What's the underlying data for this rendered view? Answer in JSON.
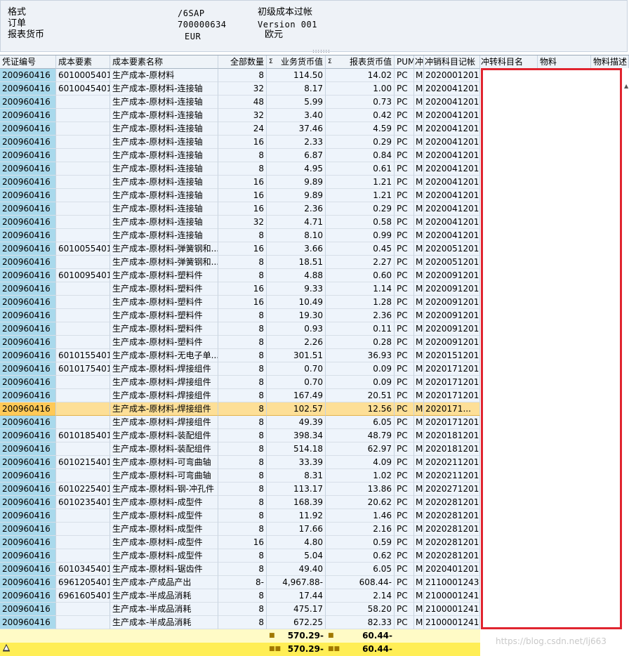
{
  "header": {
    "rows": [
      {
        "label": "格式",
        "value": "/6SAP",
        "extra": "初级成本过帐"
      },
      {
        "label": "订单",
        "value": "700000634",
        "extra": "Version 001"
      },
      {
        "label": "报表货币",
        "value": "EUR",
        "extra": "欧元"
      }
    ]
  },
  "columns": {
    "voucher": "凭证编号",
    "cost_element": "成本要素",
    "cost_element_name": "成本要素名称",
    "total_qty": "全部数量",
    "business_currency_value": "业务货币值",
    "report_currency_value": "报表货币值",
    "pum": "PUM",
    "rev": "冲",
    "offset_account": "冲销科目记帐",
    "offset_account_name": "冲转科目名",
    "material": "物料",
    "material_desc": "物料描述",
    "sigma": "Σ"
  },
  "rows": [
    {
      "v": "200960416",
      "ce": "6010005401",
      "name": "生产成本-原材料",
      "qty": "8",
      "bv": "114.50",
      "rv": "14.02",
      "pum": "PC",
      "m": "M",
      "acc": "2020001201"
    },
    {
      "v": "200960416",
      "ce": "6010045401",
      "name": "生产成本-原材料-连接轴",
      "qty": "32",
      "bv": "8.17",
      "rv": "1.00",
      "pum": "PC",
      "m": "M",
      "acc": "2020041201"
    },
    {
      "v": "200960416",
      "ce": "",
      "name": "生产成本-原材料-连接轴",
      "qty": "48",
      "bv": "5.99",
      "rv": "0.73",
      "pum": "PC",
      "m": "M",
      "acc": "2020041201"
    },
    {
      "v": "200960416",
      "ce": "",
      "name": "生产成本-原材料-连接轴",
      "qty": "32",
      "bv": "3.40",
      "rv": "0.42",
      "pum": "PC",
      "m": "M",
      "acc": "2020041201"
    },
    {
      "v": "200960416",
      "ce": "",
      "name": "生产成本-原材料-连接轴",
      "qty": "24",
      "bv": "37.46",
      "rv": "4.59",
      "pum": "PC",
      "m": "M",
      "acc": "2020041201"
    },
    {
      "v": "200960416",
      "ce": "",
      "name": "生产成本-原材料-连接轴",
      "qty": "16",
      "bv": "2.33",
      "rv": "0.29",
      "pum": "PC",
      "m": "M",
      "acc": "2020041201"
    },
    {
      "v": "200960416",
      "ce": "",
      "name": "生产成本-原材料-连接轴",
      "qty": "8",
      "bv": "6.87",
      "rv": "0.84",
      "pum": "PC",
      "m": "M",
      "acc": "2020041201"
    },
    {
      "v": "200960416",
      "ce": "",
      "name": "生产成本-原材料-连接轴",
      "qty": "8",
      "bv": "4.95",
      "rv": "0.61",
      "pum": "PC",
      "m": "M",
      "acc": "2020041201"
    },
    {
      "v": "200960416",
      "ce": "",
      "name": "生产成本-原材料-连接轴",
      "qty": "16",
      "bv": "9.89",
      "rv": "1.21",
      "pum": "PC",
      "m": "M",
      "acc": "2020041201"
    },
    {
      "v": "200960416",
      "ce": "",
      "name": "生产成本-原材料-连接轴",
      "qty": "16",
      "bv": "9.89",
      "rv": "1.21",
      "pum": "PC",
      "m": "M",
      "acc": "2020041201"
    },
    {
      "v": "200960416",
      "ce": "",
      "name": "生产成本-原材料-连接轴",
      "qty": "16",
      "bv": "2.36",
      "rv": "0.29",
      "pum": "PC",
      "m": "M",
      "acc": "2020041201"
    },
    {
      "v": "200960416",
      "ce": "",
      "name": "生产成本-原材料-连接轴",
      "qty": "32",
      "bv": "4.71",
      "rv": "0.58",
      "pum": "PC",
      "m": "M",
      "acc": "2020041201"
    },
    {
      "v": "200960416",
      "ce": "",
      "name": "生产成本-原材料-连接轴",
      "qty": "8",
      "bv": "8.10",
      "rv": "0.99",
      "pum": "PC",
      "m": "M",
      "acc": "2020041201"
    },
    {
      "v": "200960416",
      "ce": "6010055401",
      "name": "生产成本-原材料-弹簧钢和...",
      "qty": "16",
      "bv": "3.66",
      "rv": "0.45",
      "pum": "PC",
      "m": "M",
      "acc": "2020051201"
    },
    {
      "v": "200960416",
      "ce": "",
      "name": "生产成本-原材料-弹簧钢和...",
      "qty": "8",
      "bv": "18.51",
      "rv": "2.27",
      "pum": "PC",
      "m": "M",
      "acc": "2020051201"
    },
    {
      "v": "200960416",
      "ce": "6010095401",
      "name": "生产成本-原材料-塑料件",
      "qty": "8",
      "bv": "4.88",
      "rv": "0.60",
      "pum": "PC",
      "m": "M",
      "acc": "2020091201"
    },
    {
      "v": "200960416",
      "ce": "",
      "name": "生产成本-原材料-塑料件",
      "qty": "16",
      "bv": "9.33",
      "rv": "1.14",
      "pum": "PC",
      "m": "M",
      "acc": "2020091201"
    },
    {
      "v": "200960416",
      "ce": "",
      "name": "生产成本-原材料-塑料件",
      "qty": "16",
      "bv": "10.49",
      "rv": "1.28",
      "pum": "PC",
      "m": "M",
      "acc": "2020091201"
    },
    {
      "v": "200960416",
      "ce": "",
      "name": "生产成本-原材料-塑料件",
      "qty": "8",
      "bv": "19.30",
      "rv": "2.36",
      "pum": "PC",
      "m": "M",
      "acc": "2020091201"
    },
    {
      "v": "200960416",
      "ce": "",
      "name": "生产成本-原材料-塑料件",
      "qty": "8",
      "bv": "0.93",
      "rv": "0.11",
      "pum": "PC",
      "m": "M",
      "acc": "2020091201"
    },
    {
      "v": "200960416",
      "ce": "",
      "name": "生产成本-原材料-塑料件",
      "qty": "8",
      "bv": "2.26",
      "rv": "0.28",
      "pum": "PC",
      "m": "M",
      "acc": "2020091201"
    },
    {
      "v": "200960416",
      "ce": "6010155401",
      "name": "生产成本-原材料-无电子单...",
      "qty": "8",
      "bv": "301.51",
      "rv": "36.93",
      "pum": "PC",
      "m": "M",
      "acc": "2020151201"
    },
    {
      "v": "200960416",
      "ce": "6010175401",
      "name": "生产成本-原材料-焊接组件",
      "qty": "8",
      "bv": "0.70",
      "rv": "0.09",
      "pum": "PC",
      "m": "M",
      "acc": "2020171201"
    },
    {
      "v": "200960416",
      "ce": "",
      "name": "生产成本-原材料-焊接组件",
      "qty": "8",
      "bv": "0.70",
      "rv": "0.09",
      "pum": "PC",
      "m": "M",
      "acc": "2020171201"
    },
    {
      "v": "200960416",
      "ce": "",
      "name": "生产成本-原材料-焊接组件",
      "qty": "8",
      "bv": "167.49",
      "rv": "20.51",
      "pum": "PC",
      "m": "M",
      "acc": "2020171201"
    },
    {
      "v": "200960416",
      "ce": "",
      "name": "生产成本-原材料-焊接组件",
      "qty": "8",
      "bv": "102.57",
      "rv": "12.56",
      "pum": "PC",
      "m": "M",
      "acc": "2020171...",
      "selected": true
    },
    {
      "v": "200960416",
      "ce": "",
      "name": "生产成本-原材料-焊接组件",
      "qty": "8",
      "bv": "49.39",
      "rv": "6.05",
      "pum": "PC",
      "m": "M",
      "acc": "2020171201"
    },
    {
      "v": "200960416",
      "ce": "6010185401",
      "name": "生产成本-原材料-装配组件",
      "qty": "8",
      "bv": "398.34",
      "rv": "48.79",
      "pum": "PC",
      "m": "M",
      "acc": "2020181201"
    },
    {
      "v": "200960416",
      "ce": "",
      "name": "生产成本-原材料-装配组件",
      "qty": "8",
      "bv": "514.18",
      "rv": "62.97",
      "pum": "PC",
      "m": "M",
      "acc": "2020181201"
    },
    {
      "v": "200960416",
      "ce": "6010215401",
      "name": "生产成本-原材料-可弯曲轴",
      "qty": "8",
      "bv": "33.39",
      "rv": "4.09",
      "pum": "PC",
      "m": "M",
      "acc": "2020211201"
    },
    {
      "v": "200960416",
      "ce": "",
      "name": "生产成本-原材料-可弯曲轴",
      "qty": "8",
      "bv": "8.31",
      "rv": "1.02",
      "pum": "PC",
      "m": "M",
      "acc": "2020211201"
    },
    {
      "v": "200960416",
      "ce": "6010225401",
      "name": "生产成本-原材料-钢-冲孔件",
      "qty": "8",
      "bv": "113.17",
      "rv": "13.86",
      "pum": "PC",
      "m": "M",
      "acc": "2020271201"
    },
    {
      "v": "200960416",
      "ce": "6010235401",
      "name": "生产成本-原材料-成型件",
      "qty": "8",
      "bv": "168.39",
      "rv": "20.62",
      "pum": "PC",
      "m": "M",
      "acc": "2020281201"
    },
    {
      "v": "200960416",
      "ce": "",
      "name": "生产成本-原材料-成型件",
      "qty": "8",
      "bv": "11.92",
      "rv": "1.46",
      "pum": "PC",
      "m": "M",
      "acc": "2020281201"
    },
    {
      "v": "200960416",
      "ce": "",
      "name": "生产成本-原材料-成型件",
      "qty": "8",
      "bv": "17.66",
      "rv": "2.16",
      "pum": "PC",
      "m": "M",
      "acc": "2020281201"
    },
    {
      "v": "200960416",
      "ce": "",
      "name": "生产成本-原材料-成型件",
      "qty": "16",
      "bv": "4.80",
      "rv": "0.59",
      "pum": "PC",
      "m": "M",
      "acc": "2020281201"
    },
    {
      "v": "200960416",
      "ce": "",
      "name": "生产成本-原材料-成型件",
      "qty": "8",
      "bv": "5.04",
      "rv": "0.62",
      "pum": "PC",
      "m": "M",
      "acc": "2020281201"
    },
    {
      "v": "200960416",
      "ce": "6010345401",
      "name": "生产成本-原材料-锯齿件",
      "qty": "8",
      "bv": "49.40",
      "rv": "6.05",
      "pum": "PC",
      "m": "M",
      "acc": "2020401201"
    },
    {
      "v": "200960416",
      "ce": "6961205401",
      "name": "生产成本-产成品产出",
      "qty": "8-",
      "bv": "4,967.88-",
      "rv": "608.44-",
      "pum": "PC",
      "m": "M",
      "acc": "2110001243"
    },
    {
      "v": "200960416",
      "ce": "6961605401",
      "name": "生产成本-半成品消耗",
      "qty": "8",
      "bv": "17.44",
      "rv": "2.14",
      "pum": "PC",
      "m": "M",
      "acc": "2100001241"
    },
    {
      "v": "200960416",
      "ce": "",
      "name": "生产成本-半成品消耗",
      "qty": "8",
      "bv": "475.17",
      "rv": "58.20",
      "pum": "PC",
      "m": "M",
      "acc": "2100001241"
    },
    {
      "v": "200960416",
      "ce": "",
      "name": "生产成本-半成品消耗",
      "qty": "8",
      "bv": "672.25",
      "rv": "82.33",
      "pum": "PC",
      "m": "M",
      "acc": "2100001241"
    }
  ],
  "totals": [
    {
      "dots": "■",
      "bv": "570.29-",
      "dots2": "■",
      "rv": "60.44-"
    },
    {
      "dots": "■■",
      "bv": "570.29-",
      "dots2": "■■",
      "rv": "60.44-"
    }
  ],
  "watermark": "https://blog.csdn.net/lj663",
  "colors": {
    "highlight": "#e0242f",
    "selected_row": "#fddf97",
    "total_row": "#ffee55"
  }
}
